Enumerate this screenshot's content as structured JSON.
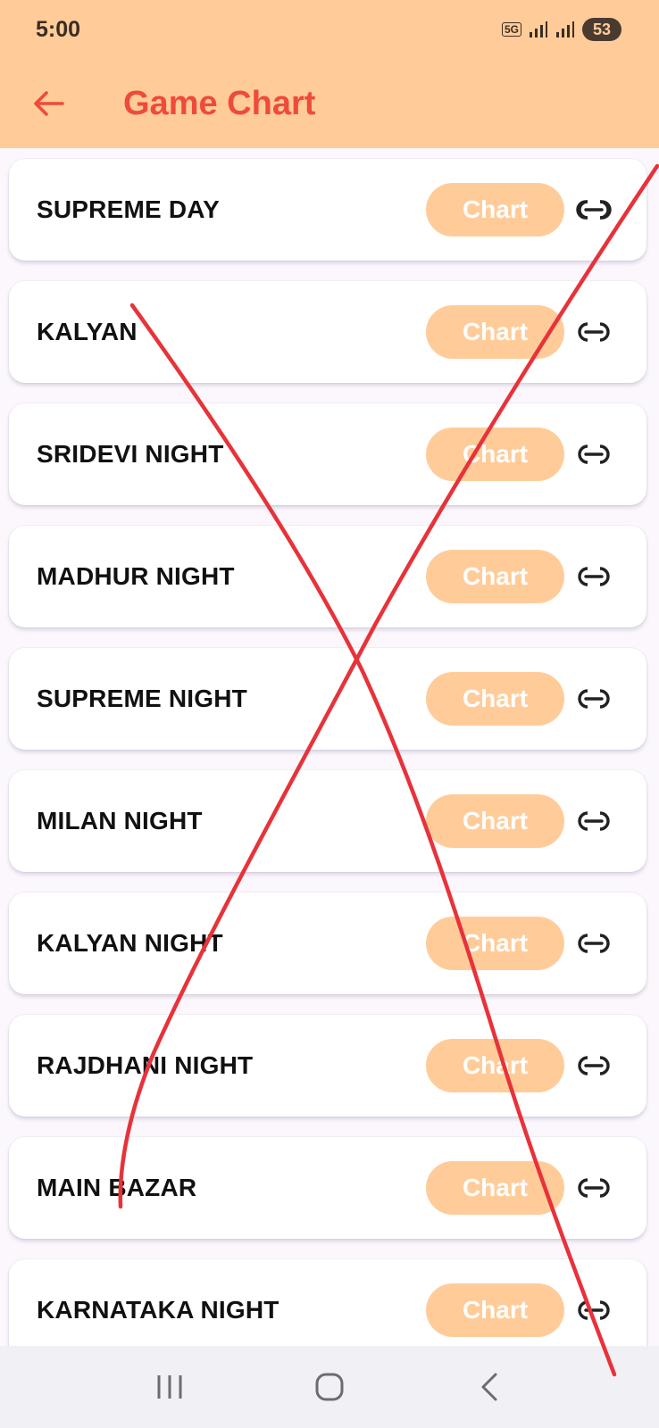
{
  "status_bar": {
    "time": "5:00",
    "network_label": "5G",
    "battery": "53"
  },
  "header": {
    "title": "Game Chart",
    "back_icon": "arrow-left-icon"
  },
  "colors": {
    "accent": "#ffcc99",
    "title": "#ef4a3a",
    "annotation": "#e8323a"
  },
  "games": [
    {
      "name": "SUPREME DAY",
      "button_label": "Chart"
    },
    {
      "name": "KALYAN",
      "button_label": "Chart"
    },
    {
      "name": "SRIDEVI NIGHT",
      "button_label": "Chart"
    },
    {
      "name": "MADHUR NIGHT",
      "button_label": "Chart"
    },
    {
      "name": "SUPREME NIGHT",
      "button_label": "Chart"
    },
    {
      "name": "MILAN NIGHT",
      "button_label": "Chart"
    },
    {
      "name": "KALYAN NIGHT",
      "button_label": "Chart"
    },
    {
      "name": "RAJDHANI NIGHT",
      "button_label": "Chart"
    },
    {
      "name": "MAIN BAZAR",
      "button_label": "Chart"
    },
    {
      "name": "KARNATAKA NIGHT",
      "button_label": "Chart"
    }
  ],
  "nav_bar": {
    "items": [
      "recents-icon",
      "home-icon",
      "back-icon"
    ]
  }
}
